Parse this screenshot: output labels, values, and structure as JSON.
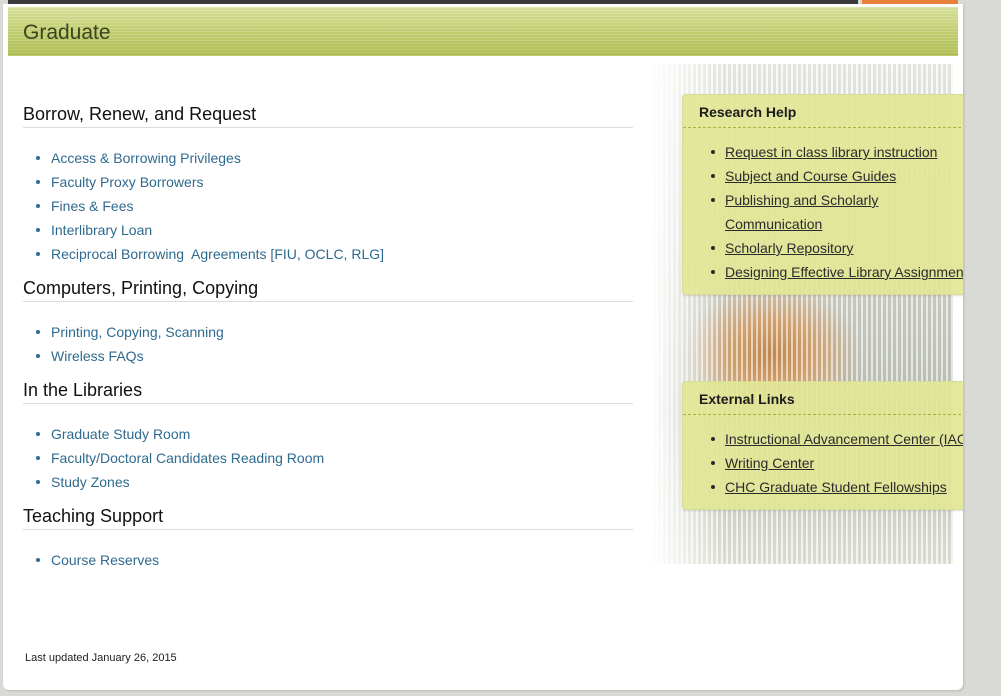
{
  "banner": {
    "title": "Graduate"
  },
  "sections": [
    {
      "heading": "Borrow, Renew, and Request",
      "links": [
        "Access & Borrowing Privileges",
        "Faculty Proxy Borrowers",
        "Fines & Fees",
        "Interlibrary Loan",
        "Reciprocal Borrowing  Agreements [FIU, OCLC, RLG]"
      ]
    },
    {
      "heading": "Computers, Printing, Copying",
      "links": [
        "Printing, Copying, Scanning",
        "Wireless FAQs"
      ]
    },
    {
      "heading": "In the Libraries",
      "links": [
        "Graduate Study Room",
        "Faculty/Doctoral Candidates Reading Room",
        "Study Zones"
      ]
    },
    {
      "heading": "Teaching Support",
      "links": [
        "Course Reserves"
      ]
    }
  ],
  "footer": {
    "last_updated": "Last updated January 26, 2015"
  },
  "research_help": {
    "title": "Research Help",
    "links": [
      "Request in class library instruction",
      "Subject and Course Guides",
      "Publishing and Scholarly Communication",
      "Scholarly Repository",
      "Designing Effective Library Assignments"
    ]
  },
  "external_links": {
    "title": "External Links",
    "links": [
      "Instructional Advancement Center (IAC)",
      "Writing Center",
      "CHC Graduate Student Fellowships"
    ]
  },
  "colors": {
    "banner": "#bcc96a",
    "link": "#2f6a8f",
    "panel": "#e1e696",
    "accent_orange": "#e8823a"
  }
}
